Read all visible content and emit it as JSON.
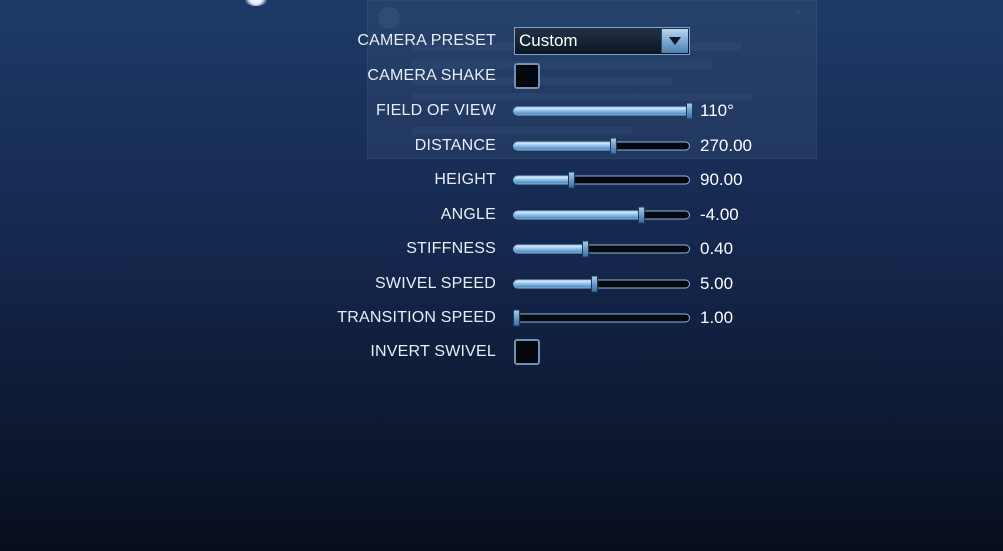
{
  "camera_settings": {
    "preset": {
      "label": "CAMERA PRESET",
      "value": "Custom",
      "icon": "chevron-down-icon"
    },
    "camera_shake": {
      "label": "CAMERA SHAKE",
      "checked": false
    },
    "sliders": [
      {
        "key": "fov",
        "label": "FIELD OF VIEW",
        "value": "110°",
        "fraction": 1.0
      },
      {
        "key": "distance",
        "label": "DISTANCE",
        "value": "270.00",
        "fraction": 0.56
      },
      {
        "key": "height",
        "label": "HEIGHT",
        "value": "90.00",
        "fraction": 0.32
      },
      {
        "key": "angle",
        "label": "ANGLE",
        "value": "-4.00",
        "fraction": 0.72
      },
      {
        "key": "stiffness",
        "label": "STIFFNESS",
        "value": "0.40",
        "fraction": 0.4
      },
      {
        "key": "swivel_speed",
        "label": "SWIVEL SPEED",
        "value": "5.00",
        "fraction": 0.45
      },
      {
        "key": "transition_speed",
        "label": "TRANSITION SPEED",
        "value": "1.00",
        "fraction": 0.0
      }
    ],
    "invert_swivel": {
      "label": "INVERT SWIVEL",
      "checked": false
    }
  },
  "colors": {
    "accent": "#8fc3ec",
    "background_top": "#1d3a66",
    "background_bottom": "#080e1f"
  }
}
